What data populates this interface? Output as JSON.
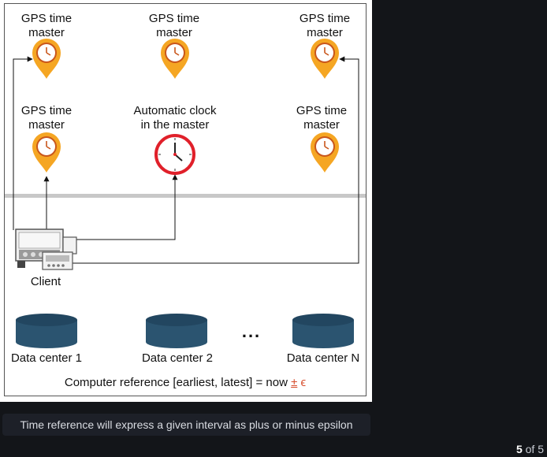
{
  "diagram": {
    "gps_label": "GPS time\nmaster",
    "auto_clock_label": "Automatic clock\nin the master",
    "client_label": "Client",
    "data_centers": [
      "Data center 1",
      "Data center 2",
      "Data center N"
    ],
    "ellipsis": "...",
    "reference_prefix": "Computer reference [earliest, latest] = now ",
    "reference_pm": "±",
    "reference_eps": "ϵ",
    "colors": {
      "pin": "#f5a623",
      "clock_red": "#e0202a",
      "database": "#2b5470",
      "border": "#555555",
      "separator": "#c8c8c8"
    }
  },
  "caption": "Time reference will express a given interval as plus or minus epsilon",
  "pager": {
    "current": "5",
    "separator": "of",
    "total": "5"
  }
}
